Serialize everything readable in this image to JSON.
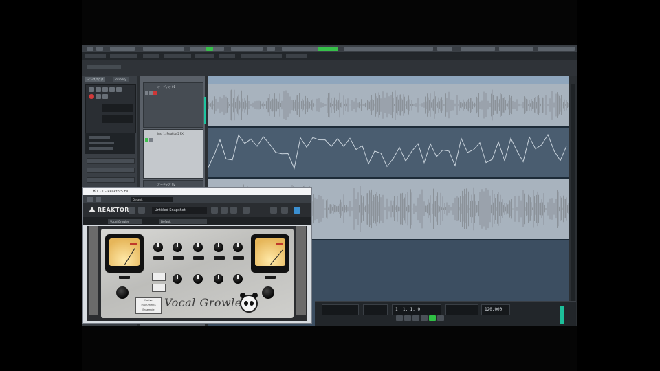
{
  "plugin": {
    "window_title": "ル1 - 1 - Reaktor5 FX",
    "host_preset": "Default",
    "reaktor_logo": "REAKTOR",
    "snapshot_name": "Untitled Snapshot",
    "ensemble_field": "Vocal Growler",
    "snapshot_field": "Default",
    "product_name": "Vocal Growler",
    "logo_box_lines": [
      "Native",
      "Instruments",
      "Ensemble"
    ]
  },
  "inspector": {
    "tabs": [
      "インスペクタ",
      "Visibility"
    ]
  },
  "tracks": [
    {
      "name": "オーディオ 01"
    },
    {
      "name": "Ins. 1: Reaktor5 FX"
    },
    {
      "name": "オーディオ 02"
    }
  ],
  "transport": {
    "position": "1. 1. 1. 0",
    "tempo": "120.000"
  },
  "colors": {
    "accent_green": "#37c04a",
    "record_red": "#d23a3a",
    "waveform": "#8b9299",
    "arrange_bg": "#1d2b38"
  }
}
